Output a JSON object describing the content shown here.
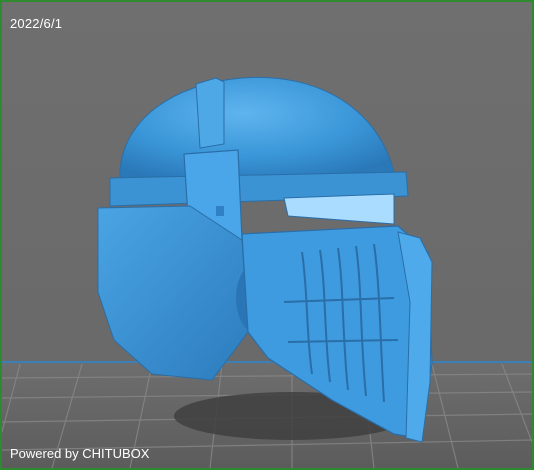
{
  "viewport": {
    "date_stamp": "2022/6/1",
    "watermark": "Powered by CHITUBOX",
    "model_color": "#3a96d8",
    "background_color": "#6a6a6a",
    "grid_color": "#7e7e7e",
    "frame_color": "#2f8a2f"
  },
  "scene": {
    "model": "helmet-skull-3d-model",
    "shadow": "ground-shadow",
    "grid": "build-plate-grid"
  }
}
